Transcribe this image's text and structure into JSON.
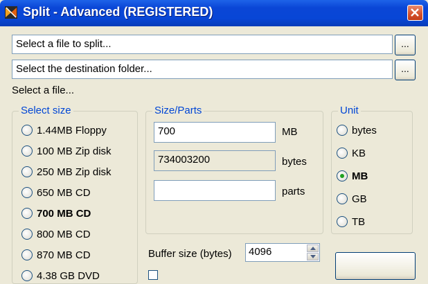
{
  "window": {
    "title": "Split - Advanced (REGISTERED)"
  },
  "file_input": {
    "value": "Select a file to split..."
  },
  "dest_input": {
    "value": "Select the destination folder..."
  },
  "browse_label": "...",
  "status_text": "Select a file...",
  "select_size": {
    "legend": "Select size",
    "options": [
      {
        "label": "1.44MB Floppy",
        "selected": false
      },
      {
        "label": "100 MB Zip disk",
        "selected": false
      },
      {
        "label": "250 MB Zip disk",
        "selected": false
      },
      {
        "label": "650 MB CD",
        "selected": false
      },
      {
        "label": "700 MB CD",
        "selected": true
      },
      {
        "label": "800 MB CD",
        "selected": false
      },
      {
        "label": "870 MB CD",
        "selected": false
      },
      {
        "label": "4.38 GB DVD",
        "selected": false
      }
    ]
  },
  "size_parts": {
    "legend": "Size/Parts",
    "size_value": "700",
    "size_unit": "MB",
    "bytes_value": "734003200",
    "bytes_unit": "bytes",
    "parts_value": "",
    "parts_unit": "parts"
  },
  "unit": {
    "legend": "Unit",
    "options": [
      {
        "label": "bytes",
        "selected": false
      },
      {
        "label": "KB",
        "selected": false
      },
      {
        "label": "MB",
        "selected": true
      },
      {
        "label": "GB",
        "selected": false
      },
      {
        "label": "TB",
        "selected": false
      }
    ]
  },
  "buffer": {
    "label": "Buffer size (bytes)",
    "value": "4096"
  },
  "colors": {
    "titlebar": "#0a46d6",
    "legend_text": "#0046d5",
    "window_bg": "#ece9d8",
    "close": "#d4502b"
  }
}
